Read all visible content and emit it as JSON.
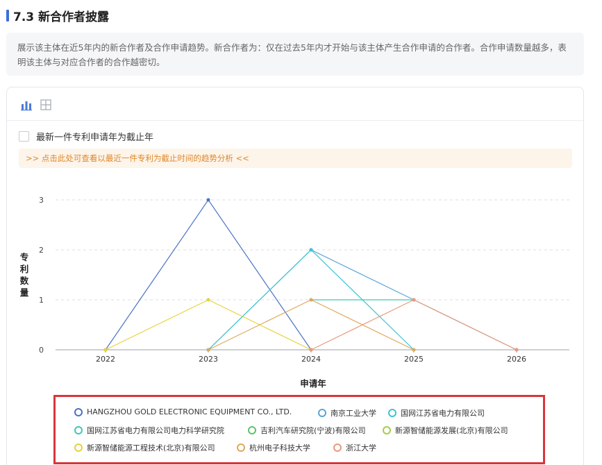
{
  "section": {
    "title": "7.3 新合作者披露",
    "description": "展示该主体在近5年内的新合作者及合作申请趋势。新合作者为：仅在过去5年内才开始与该主体产生合作申请的合作者。合作申请数量越多，表明该主体与对应合作者的合作越密切。"
  },
  "controls": {
    "bar_view_icon": "bar-chart-icon",
    "table_view_icon": "table-grid-icon",
    "checkbox_label": "最新一件专利申请年为截止年",
    "checkbox_checked": false,
    "notice_text": ">> 点击此处可查看以最近一件专利为截止时间的趋势分析 <<"
  },
  "chart_data": {
    "type": "line",
    "x": [
      "2022",
      "2023",
      "2024",
      "2025",
      "2026"
    ],
    "xlabel": "申请年",
    "ylabel": "专利数量",
    "ylim": [
      0,
      3
    ],
    "yticks": [
      0,
      1,
      2,
      3
    ],
    "grid": true,
    "legend_position": "bottom",
    "series": [
      {
        "name": "HANGZHOU GOLD ELECTRONIC EQUIPMENT CO., LTD.",
        "color": "#4a72c4",
        "values": [
          0,
          3,
          0,
          null,
          null
        ]
      },
      {
        "name": "南京工业大学",
        "color": "#5aa5d6",
        "values": [
          null,
          0,
          2,
          1,
          0
        ]
      },
      {
        "name": "国网江苏省电力有限公司",
        "color": "#3cc4cf",
        "values": [
          null,
          0,
          2,
          0,
          null
        ]
      },
      {
        "name": "国网江苏省电力有限公司电力科学研究院",
        "color": "#3dcab2",
        "values": [
          null,
          null,
          1,
          1,
          null
        ]
      },
      {
        "name": "吉利汽车研究院(宁波)有限公司",
        "color": "#5cc46a",
        "values": [
          null,
          null,
          null,
          null,
          null
        ]
      },
      {
        "name": "新源智储能源发展(北京)有限公司",
        "color": "#a9cc45",
        "values": [
          null,
          null,
          null,
          null,
          null
        ]
      },
      {
        "name": "新源智储能源工程技术(北京)有限公司",
        "color": "#e6d23d",
        "values": [
          0,
          1,
          0,
          null,
          null
        ]
      },
      {
        "name": "杭州电子科技大学",
        "color": "#dfa85c",
        "values": [
          null,
          0,
          1,
          0,
          null
        ]
      },
      {
        "name": "浙江大学",
        "color": "#e89a7a",
        "values": [
          null,
          null,
          0,
          1,
          0
        ]
      }
    ]
  }
}
